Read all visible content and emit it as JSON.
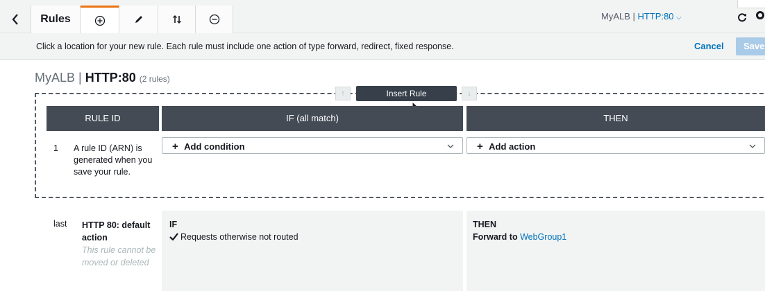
{
  "toolbar": {
    "title": "Rules",
    "listener_lb": "MyALB",
    "listener_sep": " | ",
    "listener_proto": "HTTP:80",
    "listener_chevron": "⌵",
    "icons": [
      "back-icon",
      "add-rule-icon",
      "edit-icon",
      "reorder-icon",
      "delete-icon",
      "refresh-icon",
      "help-icon"
    ],
    "accent_color": "#ec7211"
  },
  "instructions": {
    "text": "Click a location for your new rule. Each rule must include one action of type forward, redirect, fixed response.",
    "cancel": "Cancel",
    "save": "Save"
  },
  "heading": {
    "lb": "MyALB",
    "sep": " | ",
    "proto": "HTTP:80",
    "count": "(2 rules)"
  },
  "insert": {
    "label": "Insert Rule",
    "up": "↑",
    "down": "↓"
  },
  "columns": {
    "rule_id": "RULE ID",
    "if": "IF (all match)",
    "then": "THEN"
  },
  "new_rule": {
    "number": "1",
    "arn_note": "A rule ID (ARN) is generated when you save your rule.",
    "add_condition": "Add condition",
    "add_action": "Add action",
    "plus": "+"
  },
  "default_rule": {
    "position": "last",
    "title": "HTTP 80: default action",
    "note": "This rule cannot be moved or deleted",
    "if_label": "IF",
    "condition": "Requests otherwise not routed",
    "then_label": "THEN",
    "forward_to": "Forward to",
    "target_group": "WebGroup1"
  }
}
